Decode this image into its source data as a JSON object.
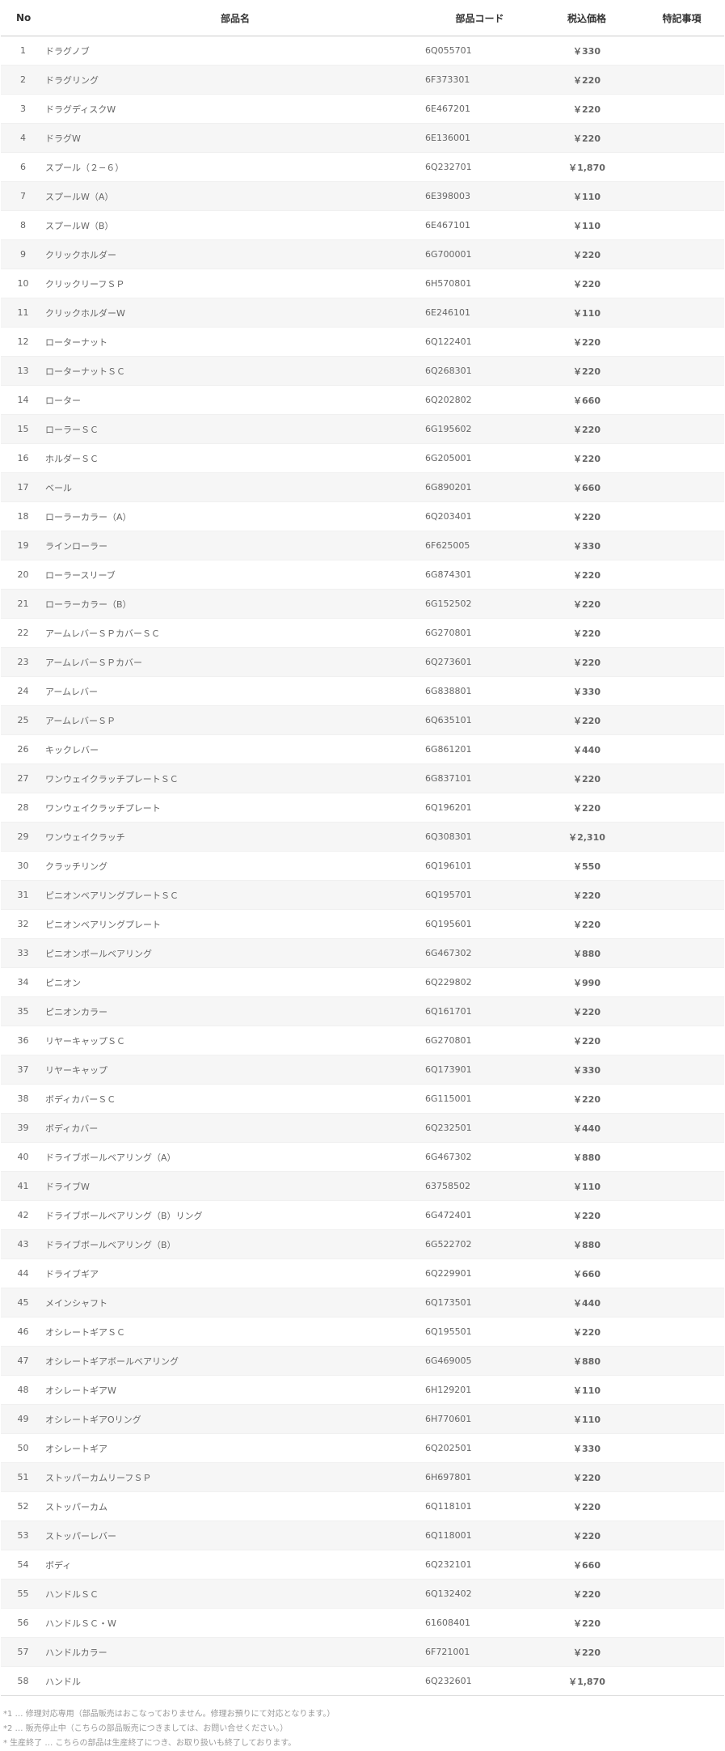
{
  "table": {
    "headers": {
      "no": "No",
      "name": "部品名",
      "code": "部品コード",
      "price": "税込価格",
      "note": "特記事項"
    },
    "rows": [
      {
        "no": "1",
        "name": "ドラグノブ",
        "code": "6Q055701",
        "price": "￥330",
        "note": ""
      },
      {
        "no": "2",
        "name": "ドラグリング",
        "code": "6F373301",
        "price": "￥220",
        "note": ""
      },
      {
        "no": "3",
        "name": "ドラグディスクW",
        "code": "6E467201",
        "price": "￥220",
        "note": ""
      },
      {
        "no": "4",
        "name": "ドラグW",
        "code": "6E136001",
        "price": "￥220",
        "note": ""
      },
      {
        "no": "6",
        "name": "スプール（２−６）",
        "code": "6Q232701",
        "price": "￥1,870",
        "note": ""
      },
      {
        "no": "7",
        "name": "スプールW（A）",
        "code": "6E398003",
        "price": "￥110",
        "note": ""
      },
      {
        "no": "8",
        "name": "スプールW（B）",
        "code": "6E467101",
        "price": "￥110",
        "note": ""
      },
      {
        "no": "9",
        "name": "クリックホルダー",
        "code": "6G700001",
        "price": "￥220",
        "note": ""
      },
      {
        "no": "10",
        "name": "クリックリーフＳＰ",
        "code": "6H570801",
        "price": "￥220",
        "note": ""
      },
      {
        "no": "11",
        "name": "クリックホルダーW",
        "code": "6E246101",
        "price": "￥110",
        "note": ""
      },
      {
        "no": "12",
        "name": "ローターナット",
        "code": "6Q122401",
        "price": "￥220",
        "note": ""
      },
      {
        "no": "13",
        "name": "ローターナットＳＣ",
        "code": "6Q268301",
        "price": "￥220",
        "note": ""
      },
      {
        "no": "14",
        "name": "ローター",
        "code": "6Q202802",
        "price": "￥660",
        "note": ""
      },
      {
        "no": "15",
        "name": "ローラーＳＣ",
        "code": "6G195602",
        "price": "￥220",
        "note": ""
      },
      {
        "no": "16",
        "name": "ホルダーＳＣ",
        "code": "6G205001",
        "price": "￥220",
        "note": ""
      },
      {
        "no": "17",
        "name": "ベール",
        "code": "6G890201",
        "price": "￥660",
        "note": ""
      },
      {
        "no": "18",
        "name": "ローラーカラー（A）",
        "code": "6Q203401",
        "price": "￥220",
        "note": ""
      },
      {
        "no": "19",
        "name": "ラインローラー",
        "code": "6F625005",
        "price": "￥330",
        "note": ""
      },
      {
        "no": "20",
        "name": "ローラースリーブ",
        "code": "6G874301",
        "price": "￥220",
        "note": ""
      },
      {
        "no": "21",
        "name": "ローラーカラー（B）",
        "code": "6G152502",
        "price": "￥220",
        "note": ""
      },
      {
        "no": "22",
        "name": "アームレバーＳＰカバーＳＣ",
        "code": "6G270801",
        "price": "￥220",
        "note": ""
      },
      {
        "no": "23",
        "name": "アームレバーＳＰカバー",
        "code": "6Q273601",
        "price": "￥220",
        "note": ""
      },
      {
        "no": "24",
        "name": "アームレバー",
        "code": "6G838801",
        "price": "￥330",
        "note": ""
      },
      {
        "no": "25",
        "name": "アームレバーＳＰ",
        "code": "6Q635101",
        "price": "￥220",
        "note": ""
      },
      {
        "no": "26",
        "name": "キックレバー",
        "code": "6G861201",
        "price": "￥440",
        "note": ""
      },
      {
        "no": "27",
        "name": "ワンウェイクラッチプレートＳＣ",
        "code": "6G837101",
        "price": "￥220",
        "note": ""
      },
      {
        "no": "28",
        "name": "ワンウェイクラッチプレート",
        "code": "6Q196201",
        "price": "￥220",
        "note": ""
      },
      {
        "no": "29",
        "name": "ワンウェイクラッチ",
        "code": "6Q308301",
        "price": "￥2,310",
        "note": ""
      },
      {
        "no": "30",
        "name": "クラッチリング",
        "code": "6Q196101",
        "price": "￥550",
        "note": ""
      },
      {
        "no": "31",
        "name": "ピニオンベアリングプレートＳＣ",
        "code": "6Q195701",
        "price": "￥220",
        "note": ""
      },
      {
        "no": "32",
        "name": "ピニオンベアリングプレート",
        "code": "6Q195601",
        "price": "￥220",
        "note": ""
      },
      {
        "no": "33",
        "name": "ピニオンボールベアリング",
        "code": "6G467302",
        "price": "￥880",
        "note": ""
      },
      {
        "no": "34",
        "name": "ピニオン",
        "code": "6Q229802",
        "price": "￥990",
        "note": ""
      },
      {
        "no": "35",
        "name": "ピニオンカラー",
        "code": "6Q161701",
        "price": "￥220",
        "note": ""
      },
      {
        "no": "36",
        "name": "リヤーキャップＳＣ",
        "code": "6G270801",
        "price": "￥220",
        "note": ""
      },
      {
        "no": "37",
        "name": "リヤーキャップ",
        "code": "6Q173901",
        "price": "￥330",
        "note": ""
      },
      {
        "no": "38",
        "name": "ボディカバーＳＣ",
        "code": "6G115001",
        "price": "￥220",
        "note": ""
      },
      {
        "no": "39",
        "name": "ボディカバー",
        "code": "6Q232501",
        "price": "￥440",
        "note": ""
      },
      {
        "no": "40",
        "name": "ドライブボールベアリング（A）",
        "code": "6G467302",
        "price": "￥880",
        "note": ""
      },
      {
        "no": "41",
        "name": "ドライブW",
        "code": "63758502",
        "price": "￥110",
        "note": ""
      },
      {
        "no": "42",
        "name": "ドライブボールベアリング（B）リング",
        "code": "6G472401",
        "price": "￥220",
        "note": ""
      },
      {
        "no": "43",
        "name": "ドライブボールベアリング（B）",
        "code": "6G522702",
        "price": "￥880",
        "note": ""
      },
      {
        "no": "44",
        "name": "ドライブギア",
        "code": "6Q229901",
        "price": "￥660",
        "note": ""
      },
      {
        "no": "45",
        "name": "メインシャフト",
        "code": "6Q173501",
        "price": "￥440",
        "note": ""
      },
      {
        "no": "46",
        "name": "オシレートギアＳＣ",
        "code": "6Q195501",
        "price": "￥220",
        "note": ""
      },
      {
        "no": "47",
        "name": "オシレートギアボールベアリング",
        "code": "6G469005",
        "price": "￥880",
        "note": ""
      },
      {
        "no": "48",
        "name": "オシレートギアW",
        "code": "6H129201",
        "price": "￥110",
        "note": ""
      },
      {
        "no": "49",
        "name": "オシレートギアOリング",
        "code": "6H770601",
        "price": "￥110",
        "note": ""
      },
      {
        "no": "50",
        "name": "オシレートギア",
        "code": "6Q202501",
        "price": "￥330",
        "note": ""
      },
      {
        "no": "51",
        "name": "ストッパーカムリーフＳＰ",
        "code": "6H697801",
        "price": "￥220",
        "note": ""
      },
      {
        "no": "52",
        "name": "ストッパーカム",
        "code": "6Q118101",
        "price": "￥220",
        "note": ""
      },
      {
        "no": "53",
        "name": "ストッパーレバー",
        "code": "6Q118001",
        "price": "￥220",
        "note": ""
      },
      {
        "no": "54",
        "name": "ボディ",
        "code": "6Q232101",
        "price": "￥660",
        "note": ""
      },
      {
        "no": "55",
        "name": "ハンドルＳＣ",
        "code": "6Q132402",
        "price": "￥220",
        "note": ""
      },
      {
        "no": "56",
        "name": "ハンドルＳＣ・W",
        "code": "61608401",
        "price": "￥220",
        "note": ""
      },
      {
        "no": "57",
        "name": "ハンドルカラー",
        "code": "6F721001",
        "price": "￥220",
        "note": ""
      },
      {
        "no": "58",
        "name": "ハンドル",
        "code": "6Q232601",
        "price": "￥1,870",
        "note": ""
      }
    ]
  },
  "notes": [
    "*1 … 修理対応専用（部品販売はおこなっておりません。修理お預りにて対応となります。）",
    "*2 … 販売停止中（こちらの部品販売につきましては、お問い合せください。）",
    "* 生産終了 … こちらの部品は生産終了につき、お取り扱いも終了しております。"
  ]
}
